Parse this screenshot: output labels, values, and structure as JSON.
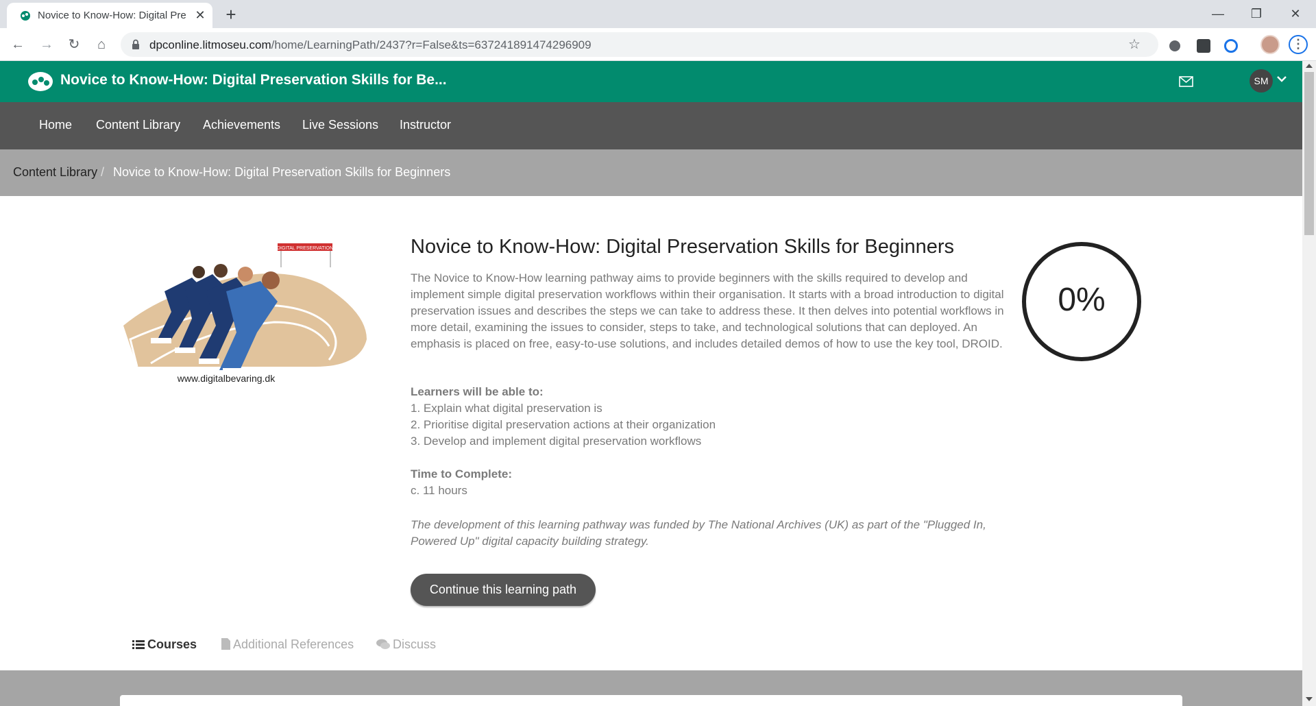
{
  "browser": {
    "tab_title": "Novice to Know-How: Digital Pre",
    "new_tab_label": "+",
    "url_host": "dpconline.litmoseu.com",
    "url_path": "/home/LearningPath/2437?r=False&ts=637241891474296909",
    "window_controls": {
      "minimize": "—",
      "maximize": "❐",
      "close": "✕"
    },
    "nav": {
      "back": "←",
      "forward": "→",
      "reload": "↻",
      "home": "⌂"
    }
  },
  "site": {
    "title": "Novice to Know-How: Digital Preservation Skills for Be...",
    "brand_color": "#028b6e",
    "user_initials": "SM"
  },
  "main_nav": [
    "Home",
    "Content Library",
    "Achievements",
    "Live Sessions",
    "Instructor"
  ],
  "breadcrumb": {
    "parent": "Content Library",
    "separator": "/",
    "current": "Novice to Know-How: Digital Preservation Skills for Beginners"
  },
  "course": {
    "image_caption": "www.digitalbevaring.dk",
    "image_banner": "DIGITAL PRESERVATION",
    "title": "Novice to Know-How: Digital Preservation Skills for Beginners",
    "description": "The Novice to Know-How learning pathway aims to provide beginners with the skills required to develop and implement simple digital preservation workflows within their organisation. It starts with a broad introduction to digital preservation issues and describes the steps we can take to address these. It then delves into potential workflows in more detail, examining the issues to consider, steps to take, and technological solutions that can deployed. An emphasis is placed on free, easy-to-use solutions, and includes detailed demos of how to use the key tool, DROID.",
    "learners_heading": "Learners will be able to:",
    "outcomes": [
      "1. Explain what digital preservation is",
      "2. Prioritise digital preservation actions at their organization",
      "3. Develop and implement digital preservation workflows"
    ],
    "time_heading": "Time to Complete:",
    "time_value": "c. 11 hours",
    "funding_note": "The development of this learning pathway was funded by The National Archives (UK) as part of the \"Plugged In, Powered Up\" digital capacity building strategy.",
    "progress_label": "0%",
    "progress_value": 0,
    "cta_label": "Continue this learning path"
  },
  "content_tabs": [
    {
      "label": "Courses",
      "icon": "list-icon",
      "active": true
    },
    {
      "label": "Additional References",
      "icon": "document-icon",
      "active": false
    },
    {
      "label": "Discuss",
      "icon": "comments-icon",
      "active": false
    }
  ]
}
